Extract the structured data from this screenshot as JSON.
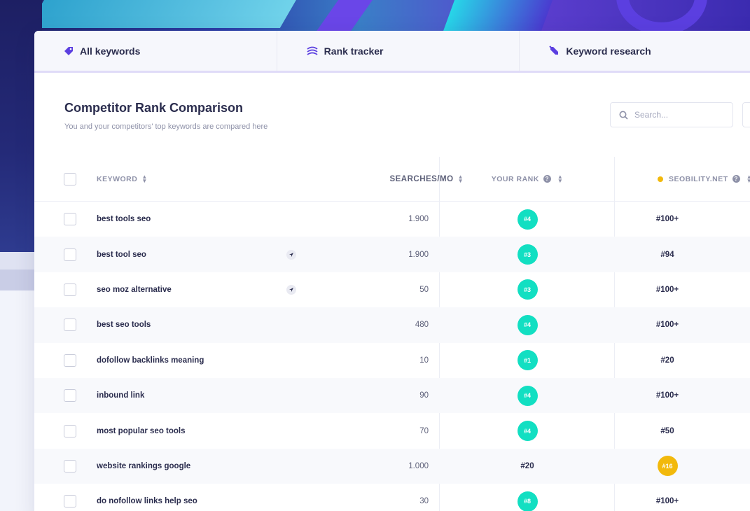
{
  "tabs": [
    {
      "label": "All keywords",
      "icon": "tag-icon"
    },
    {
      "label": "Rank tracker",
      "icon": "layers-icon"
    },
    {
      "label": "Keyword research",
      "icon": "satellite-icon"
    }
  ],
  "header": {
    "title": "Competitor Rank Comparison",
    "subtitle": "You and your competitors' top keywords are compared here"
  },
  "search": {
    "placeholder": "Search..."
  },
  "table": {
    "columns": {
      "keyword": "KEYWORD",
      "searches": "SEARCHES/MO",
      "your_rank": "YOUR RANK",
      "competitor": "SEOBILITY.NET"
    },
    "rows": [
      {
        "keyword": "best tools seo",
        "searches": "1.900",
        "your_rank": "#4",
        "competitor": "#100+",
        "flag": false
      },
      {
        "keyword": "best tool seo",
        "searches": "1.900",
        "your_rank": "#3",
        "competitor": "#94",
        "flag": true
      },
      {
        "keyword": "seo moz alternative",
        "searches": "50",
        "your_rank": "#3",
        "competitor": "#100+",
        "flag": true
      },
      {
        "keyword": "best seo tools",
        "searches": "480",
        "your_rank": "#4",
        "competitor": "#100+",
        "flag": false
      },
      {
        "keyword": "dofollow backlinks meaning",
        "searches": "10",
        "your_rank": "#1",
        "competitor": "#20",
        "flag": false
      },
      {
        "keyword": "inbound link",
        "searches": "90",
        "your_rank": "#4",
        "competitor": "#100+",
        "flag": false
      },
      {
        "keyword": "most popular seo tools",
        "searches": "70",
        "your_rank": "#4",
        "competitor": "#50",
        "flag": false
      },
      {
        "keyword": "website rankings google",
        "searches": "1.000",
        "your_rank": "#20",
        "competitor": "#16",
        "flag": false
      },
      {
        "keyword": "do nofollow links help seo",
        "searches": "30",
        "your_rank": "#8",
        "competitor": "#100+",
        "flag": false
      }
    ]
  },
  "colors": {
    "accent": "#5b3fe0",
    "rank_badge": "#12dfc2",
    "competitor_badge": "#f2b90c",
    "competitor_dot": "#f2b90c"
  }
}
